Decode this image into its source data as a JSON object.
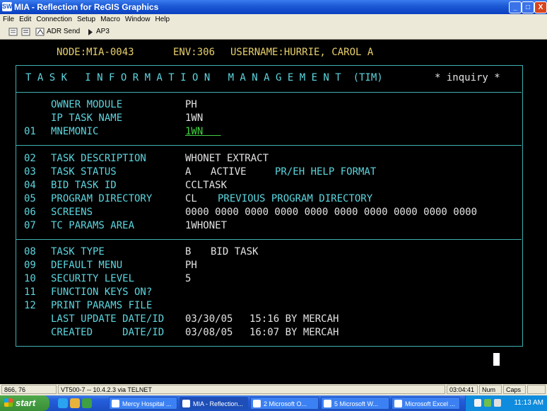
{
  "window": {
    "title": "MIA - Reflection for ReGIS Graphics",
    "app_icon": "SW",
    "controls": {
      "minimize": "_",
      "maximize": "□",
      "close": "X"
    }
  },
  "menu": [
    "File",
    "Edit",
    "Connection",
    "Setup",
    "Macro",
    "Window",
    "Help"
  ],
  "toolbar": {
    "adr_send": "ADR Send",
    "ap3": "AP3"
  },
  "terminal": {
    "header": {
      "node": "NODE:MIA-0043",
      "env": "ENV:306",
      "username": "USERNAME:HURRIE, CAROL A"
    },
    "title": "T A S K   I N F O R M A T I O N   M A N A G E M E N T  (TIM)",
    "mode": "* inquiry *",
    "section1": [
      {
        "num": "",
        "label": "OWNER MODULE",
        "value": "PH"
      },
      {
        "num": "",
        "label": "IP TASK NAME",
        "value": "1WN"
      },
      {
        "num": "01",
        "label": "MNEMONIC",
        "value": "1WN   "
      }
    ],
    "section2": [
      {
        "num": "02",
        "label": "TASK DESCRIPTION",
        "value": "WHONET EXTRACT",
        "value2": "",
        "extra": ""
      },
      {
        "num": "03",
        "label": "TASK STATUS",
        "value": "A",
        "value2": "ACTIVE",
        "extra": "PR/EH HELP FORMAT"
      },
      {
        "num": "04",
        "label": "BID TASK ID",
        "value": "CCLTASK",
        "value2": "",
        "extra": ""
      },
      {
        "num": "05",
        "label": "PROGRAM DIRECTORY",
        "value": "CL",
        "value2": "",
        "extra": "PREVIOUS PROGRAM DIRECTORY"
      },
      {
        "num": "06",
        "label": "SCREENS",
        "value": "0000 0000 0000 0000 0000 0000 0000 0000 0000 0000",
        "value2": "",
        "extra": ""
      },
      {
        "num": "07",
        "label": "TC PARAMS AREA",
        "value": "1WHONET",
        "value2": "",
        "extra": ""
      }
    ],
    "section3": [
      {
        "num": "08",
        "label": "TASK TYPE",
        "value": "B",
        "value2": "BID TASK"
      },
      {
        "num": "09",
        "label": "DEFAULT MENU",
        "value": "PH",
        "value2": ""
      },
      {
        "num": "10",
        "label": "SECURITY LEVEL",
        "value": "5",
        "value2": ""
      },
      {
        "num": "11",
        "label": "FUNCTION KEYS ON?",
        "value": "",
        "value2": ""
      },
      {
        "num": "12",
        "label": "PRINT PARAMS FILE",
        "value": "",
        "value2": ""
      },
      {
        "num": "",
        "label": "LAST UPDATE DATE/ID",
        "value": "03/30/05",
        "value2": "15:16 BY MERCAH"
      },
      {
        "num": "",
        "label": "CREATED     DATE/ID",
        "value": "03/08/05",
        "value2": "16:07 BY MERCAH"
      }
    ]
  },
  "statusbar": {
    "position": "866, 76",
    "connection": "VT500-7 -- 10.4.2.3 via TELNET",
    "timer": "03:04:41",
    "num": "Num",
    "caps": "Caps"
  },
  "taskbar": {
    "start": "start",
    "tasks": [
      "Mercy Hospital ...",
      "MIA - Reflection...",
      "2 Microsoft O...",
      "5 Microsoft W...",
      "Microsoft Excel ..."
    ],
    "clock": "11:13 AM"
  },
  "colors": {
    "title_bar": "#245edb",
    "terminal_bg": "#000000",
    "terminal_cyan": "#5cd6df",
    "terminal_yellow": "#e8d06a",
    "terminal_white": "#e2e2e2",
    "terminal_green": "#40d040",
    "taskbar": "#245edb",
    "start_button": "#3a8e37"
  }
}
